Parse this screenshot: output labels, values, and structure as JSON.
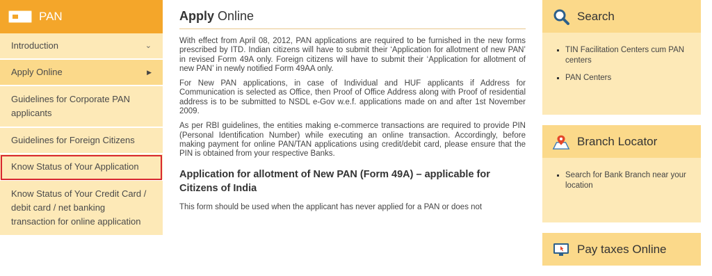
{
  "sidebar": {
    "title": "PAN",
    "items": [
      {
        "label": "Introduction"
      },
      {
        "label": "Apply Online"
      },
      {
        "label": "Guidelines for Corporate PAN applicants"
      },
      {
        "label": "Guidelines for Foreign Citizens"
      },
      {
        "label": "Know Status of Your Application"
      },
      {
        "label": "Know Status of Your Credit Card / debit card / net banking transaction for online application"
      }
    ]
  },
  "main": {
    "title_bold": "Apply",
    "title_rest": " Online",
    "paragraphs": [
      "With effect from April 08, 2012, PAN applications are required to be furnished in the new forms prescribed by ITD. Indian citizens will have to submit their ‘Application for allotment of new PAN’ in revised Form 49A only. Foreign citizens will have to submit their ‘Application for allotment of new PAN’ in newly notified Form 49AA only.",
      "For New PAN applications, in case of Individual and HUF applicants if Address for Communication is selected as Office, then Proof of Office Address along with Proof of residential address is to be submitted to NSDL e-Gov w.e.f. applications made on and after 1st November 2009.",
      "As per RBI guidelines, the entities making e-commerce transactions are required to provide PIN (Personal Identification Number) while executing an online transaction. Accordingly, before making payment for online PAN/TAN applications using credit/debit card, please ensure that the PIN is obtained from your respective Banks."
    ],
    "subheading": "Application for allotment of New PAN (Form 49A) – applicable for Citizens of India",
    "last_paragraph": "This form should be used when the applicant has never applied for a PAN or does not"
  },
  "right": {
    "search": {
      "title": "Search",
      "icon": "magnifier-icon",
      "links": [
        "TIN Facilitation Centers cum PAN centers",
        "PAN Centers"
      ]
    },
    "branch": {
      "title": "Branch Locator",
      "icon": "map-pin-icon",
      "links": [
        "Search for Bank Branch near your location"
      ]
    },
    "pay": {
      "title": "Pay taxes Online",
      "icon": "monitor-icon"
    }
  },
  "colors": {
    "accent_orange": "#f4a62a",
    "panel_bg": "#fde9b7",
    "panel_head": "#fbd98a",
    "highlight_red": "#d8282f"
  }
}
